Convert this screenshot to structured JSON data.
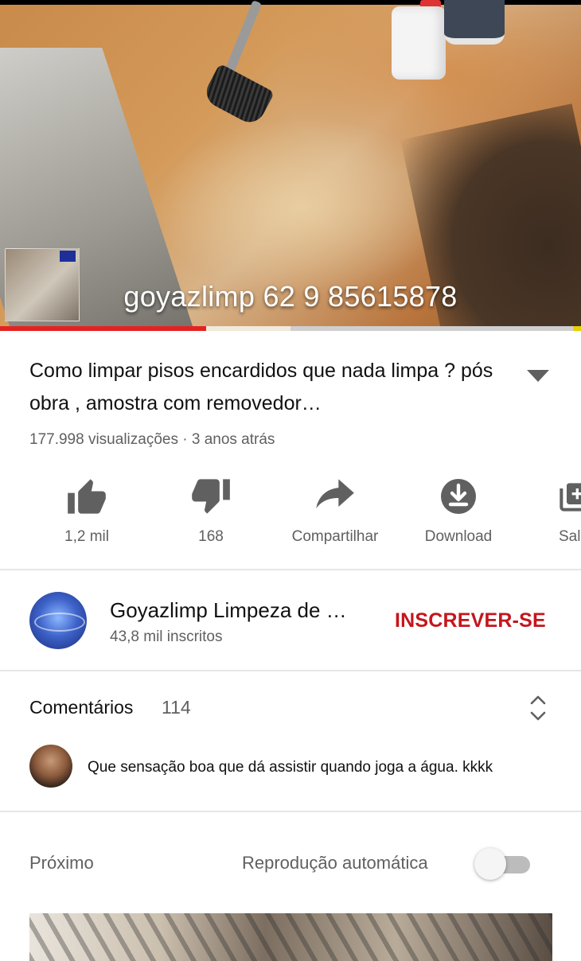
{
  "player": {
    "overlay_text": "goyazlimp 62 9 85615878",
    "progress_played": 0.355,
    "progress_buffered": 0.5
  },
  "video": {
    "title": "Como limpar pisos encardidos que nada limpa ? pós obra , amostra com removedor…",
    "meta": "177.998 visualizações · 3 anos atrás"
  },
  "actions": [
    {
      "label": "1,2 mil",
      "icon": "thumbs-up-icon"
    },
    {
      "label": "168",
      "icon": "thumbs-down-icon"
    },
    {
      "label": "Compartilhar",
      "icon": "share-icon"
    },
    {
      "label": "Download",
      "icon": "download-icon"
    },
    {
      "label": "Sal",
      "icon": "save-playlist-icon"
    }
  ],
  "channel": {
    "name": "Goyazlimp Limpeza de …",
    "subscribers": "43,8 mil inscritos",
    "subscribe_label": "INSCREVER-SE"
  },
  "comments": {
    "label": "Comentários",
    "count": "114",
    "top_comment": "Que sensação boa que dá assistir quando joga a água. kkkk"
  },
  "up_next": {
    "label": "Próximo",
    "autoplay_label": "Reprodução automática",
    "autoplay_on": false
  },
  "colors": {
    "accent_red": "#e52222",
    "subscribe_red": "#c4161c",
    "icon_gray": "#606060"
  }
}
